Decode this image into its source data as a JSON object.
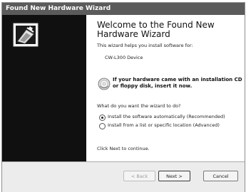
{
  "window": {
    "title": "Found New Hardware Wizard"
  },
  "wizard": {
    "heading": "Welcome to the Found New Hardware Wizard",
    "intro": "This wizard helps you install software for:",
    "device_name": "CW-L300 Device",
    "cd_notice_line1": "If your hardware came with an installation CD",
    "cd_notice_line2": "or floppy disk, insert it now.",
    "question": "What do you want the wizard to do?",
    "options": [
      {
        "label": "Install the software automatically (Recommended)",
        "selected": true
      },
      {
        "label": "Install from a list or specific location (Advanced)",
        "selected": false
      }
    ],
    "continue_hint": "Click Next to continue."
  },
  "buttons": {
    "back": "< Back",
    "next": "Next >",
    "cancel": "Cancel"
  },
  "colors": {
    "titlebar": "#5b5b5b",
    "sidebar": "#101010",
    "footer": "#ececec"
  },
  "icons": {
    "wizard": "hardware-wizard-icon",
    "cd": "cd-icon"
  }
}
